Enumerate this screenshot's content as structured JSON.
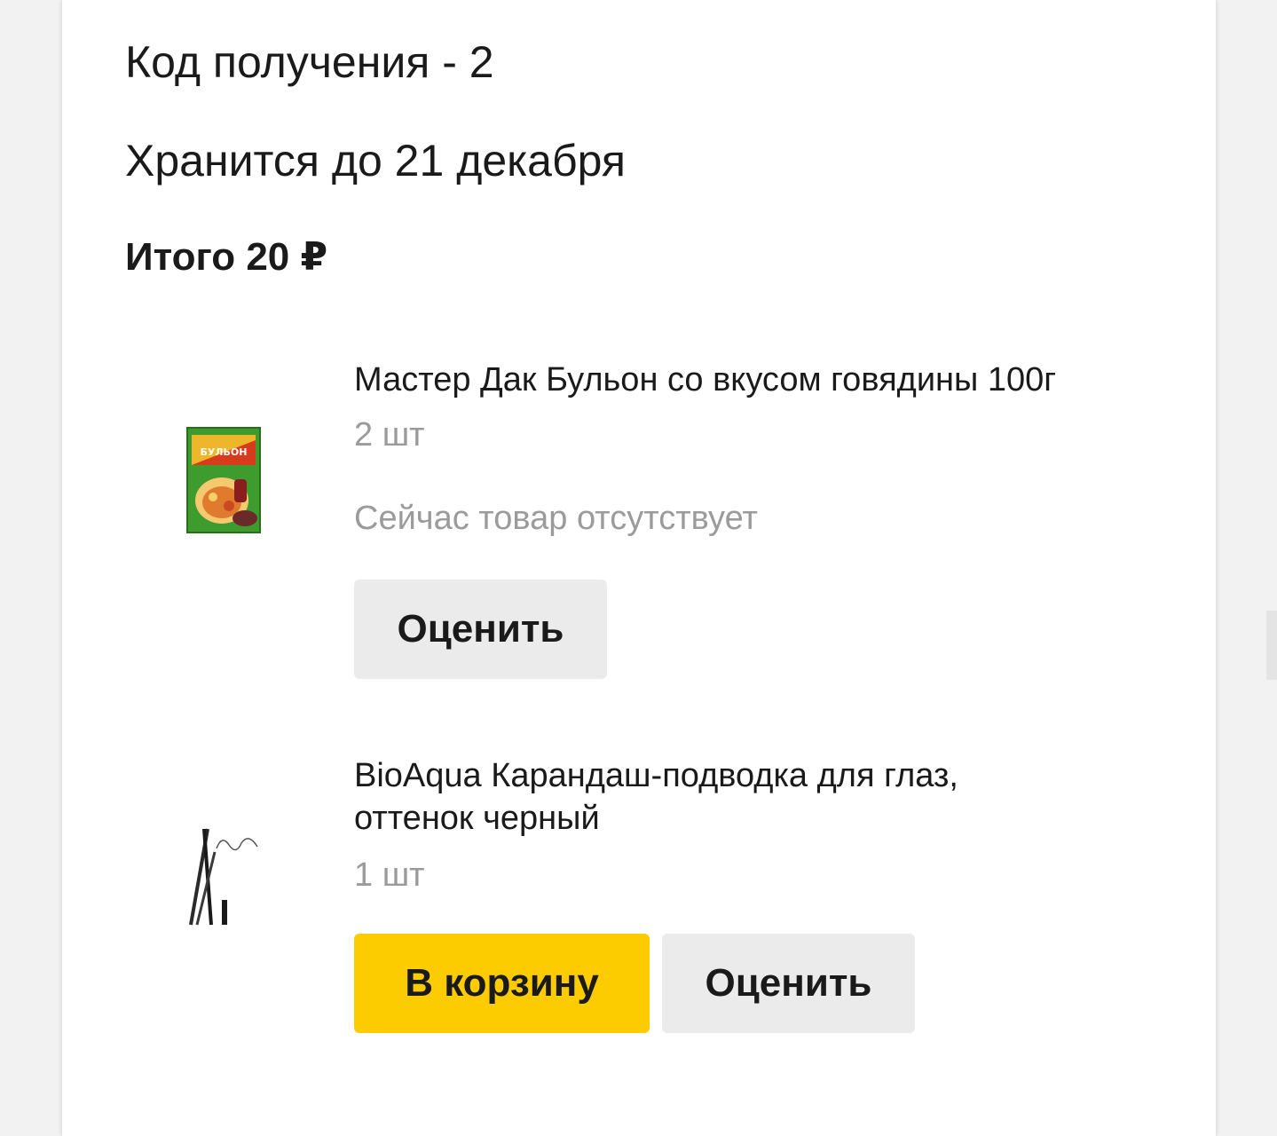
{
  "order": {
    "pickup_code": "Код получения - 2",
    "stored_until": "Хранится до 21 декабря",
    "total": "Итого 20 ₽"
  },
  "items": [
    {
      "name": "Мастер Дак Бульон со вкусом говядины 100г",
      "quantity": "2 шт",
      "availability": "Сейчас товар отсутствует",
      "rate_label": "Оценить",
      "image_icon": "broth-packet-image"
    },
    {
      "name_line1": "BioAqua Карандаш-подводка для глаз,",
      "name_line2": "оттенок черный",
      "quantity": "1 шт",
      "cart_label": "В корзину",
      "rate_label": "Оценить",
      "image_icon": "eyeliner-pencil-image"
    }
  ],
  "colors": {
    "accent_yellow": "#fccc00",
    "button_gray": "#ebebeb",
    "muted_text": "#9b9b9b"
  }
}
